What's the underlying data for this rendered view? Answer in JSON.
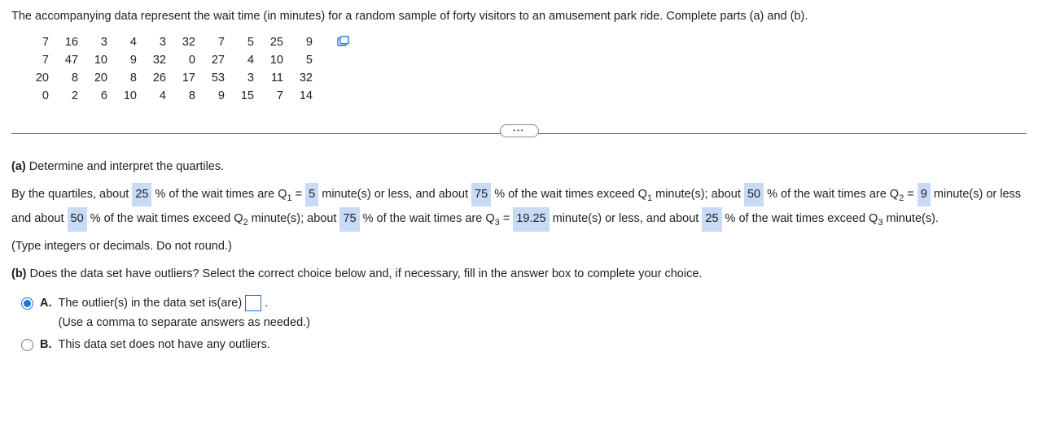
{
  "intro": "The accompanying data represent the wait time (in minutes) for a random sample of forty visitors to an amusement park ride. Complete parts (a) and (b).",
  "data_values": [
    [
      "7",
      "16",
      "3",
      "4",
      "3",
      "32",
      "7",
      "5",
      "25",
      "9"
    ],
    [
      "7",
      "47",
      "10",
      "9",
      "32",
      "0",
      "27",
      "4",
      "10",
      "5"
    ],
    [
      "20",
      "8",
      "20",
      "8",
      "26",
      "17",
      "53",
      "3",
      "11",
      "32"
    ],
    [
      "0",
      "2",
      "6",
      "10",
      "4",
      "8",
      "9",
      "15",
      "7",
      "14"
    ]
  ],
  "etc": "•••",
  "partA": {
    "labelBold": "(a)",
    "labelRest": " Determine and interpret the quartiles.",
    "t1": "By the quartiles, about ",
    "p25": "25",
    "t2": " % of the wait times are Q",
    "sub1": "1",
    "t3": " = ",
    "q1": "5",
    "t4": " minute(s) or less, and about ",
    "p75": "75",
    "t5": " % of the wait times exceed Q",
    "t6": " minute(s); about ",
    "p50": "50",
    "t7": " % of the wait times are Q",
    "sub2": "2",
    "t8": " = ",
    "q2": "9",
    "t9": " minute(s) or less and about ",
    "t10": " % of the wait times exceed Q",
    "t11": " minute(s); about ",
    "t12": " % of the wait times are Q",
    "sub3": "3",
    "t13": " = ",
    "q3": "19.25",
    "t14": " minute(s) or less, and about ",
    "t15": " % of the wait times exceed Q",
    "t16": " minute(s).",
    "hint": "(Type integers or decimals. Do not round.)"
  },
  "partB": {
    "labelBold": "(b)",
    "labelRest": " Does the data set have outliers? Select the correct choice below and, if necessary, fill in the answer box to complete your choice.",
    "optA": {
      "letter": "A.",
      "text1": "The outlier(s) in the data set is(are) ",
      "text2": ".",
      "hint": "(Use a comma to separate answers as needed.)"
    },
    "optB": {
      "letter": "B.",
      "text": "This data set does not have any outliers."
    }
  }
}
